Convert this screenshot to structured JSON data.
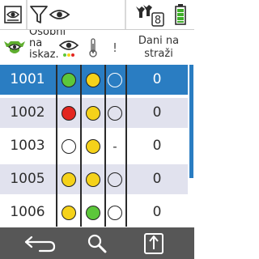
{
  "colors": {
    "selected_row": "#2a7dc2",
    "alt_row": "#e1e2ee",
    "bottom_bar": "#575757",
    "status_green": "#5cc73a",
    "status_yellow": "#f5d21a",
    "status_red": "#e32620",
    "battery_green": "#3fae2a"
  },
  "topbar": {
    "view_icon": "eye-in-box-icon",
    "filter_icon": "filter-eye-icon",
    "herd_icon": "cows-icon",
    "herd_count": "8",
    "battery_icon": "battery-icon"
  },
  "header": {
    "name_label": "Osobni\nna\niskaz.",
    "eye_icon": "eye-icon",
    "temp_icon": "thermometer-icon",
    "excl_label": "!",
    "days_label": "Dani na straži"
  },
  "rows": [
    {
      "id": "1001",
      "eye": "green",
      "temp": "yellow",
      "alert": "empty",
      "days": "0",
      "selected": true
    },
    {
      "id": "1002",
      "eye": "red",
      "temp": "yellow",
      "alert": "empty",
      "days": "0",
      "selected": false
    },
    {
      "id": "1003",
      "eye": "empty",
      "temp": "yellow",
      "alert": "-",
      "days": "0",
      "selected": false
    },
    {
      "id": "1005",
      "eye": "yellow",
      "temp": "yellow",
      "alert": "empty",
      "days": "0",
      "selected": false
    },
    {
      "id": "1006",
      "eye": "yellow",
      "temp": "green",
      "alert": "empty",
      "days": "0",
      "selected": false
    }
  ],
  "bottombar": {
    "back_icon": "back-arrow-icon",
    "search_icon": "search-icon",
    "export_icon": "export-up-icon"
  }
}
